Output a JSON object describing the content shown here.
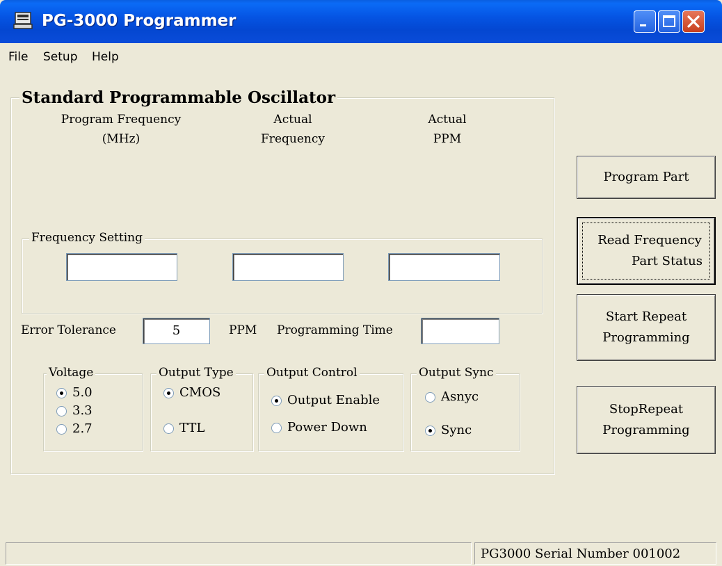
{
  "window": {
    "title": "PG-3000 Programmer"
  },
  "menu": [
    "File",
    "Setup",
    "Help"
  ],
  "main_group": {
    "legend": "Standard Programmable Oscillator",
    "col_program_frequency": [
      "Program Frequency",
      "(MHz)"
    ],
    "col_actual_frequency": [
      "Actual",
      "Frequency"
    ],
    "col_actual_ppm": [
      "Actual",
      "PPM"
    ]
  },
  "frequency_setting": {
    "legend": "Frequency Setting",
    "program_frequency_value": "",
    "actual_frequency_value": "",
    "actual_ppm_value": ""
  },
  "error_tolerance": {
    "label": "Error Tolerance",
    "value": "5",
    "unit": "PPM"
  },
  "programming_time": {
    "label": "Programming Time",
    "value": ""
  },
  "voltage": {
    "legend": "Voltage",
    "options": [
      "5.0",
      "3.3",
      "2.7"
    ],
    "selected": "5.0"
  },
  "output_type": {
    "legend": "Output Type",
    "options": [
      "CMOS",
      "TTL"
    ],
    "selected": "CMOS"
  },
  "output_control": {
    "legend": "Output Control",
    "options": [
      "Output Enable",
      "Power Down"
    ],
    "selected": "Output Enable"
  },
  "output_sync": {
    "legend": "Output Sync",
    "options": [
      "Asnyc",
      "Sync"
    ],
    "selected": "Sync"
  },
  "buttons": {
    "program_part": "Program Part",
    "read_frequency": [
      "Read Frequency",
      "Part Status"
    ],
    "start_repeat": [
      "Start Repeat",
      "Programming"
    ],
    "stop_repeat": [
      "StopRepeat",
      "Programming"
    ]
  },
  "status": {
    "serial": "PG3000 Serial Number 001002"
  },
  "colors": {
    "titlebar": "#0554e3",
    "window_bg": "#ece9d8",
    "close_button": "#c7401e"
  }
}
